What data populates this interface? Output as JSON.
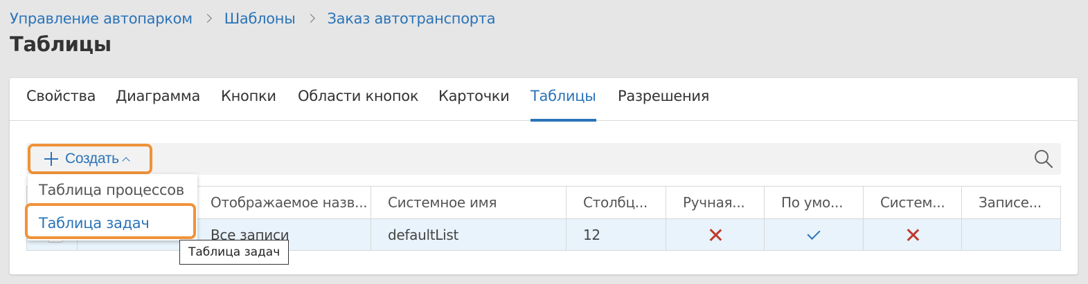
{
  "breadcrumb": {
    "items": [
      "Управление автопарком",
      "Шаблоны",
      "Заказ автотранспорта"
    ]
  },
  "page_title": "Таблицы",
  "tabs": [
    {
      "label": "Свойства",
      "active": false
    },
    {
      "label": "Диаграмма",
      "active": false
    },
    {
      "label": "Кнопки",
      "active": false
    },
    {
      "label": "Области кнопок",
      "active": false
    },
    {
      "label": "Карточки",
      "active": false
    },
    {
      "label": "Таблицы",
      "active": true
    },
    {
      "label": "Разрешения",
      "active": false
    }
  ],
  "toolbar": {
    "create_label": "Создать",
    "create_icon": "plus-icon",
    "search_icon": "search-icon"
  },
  "create_menu": {
    "items": [
      "Таблица процессов",
      "Таблица задач"
    ],
    "highlighted": "Таблица задач"
  },
  "table": {
    "columns": [
      "Отображаемое назв...",
      "Системное имя",
      "Столбц...",
      "Ручная...",
      "По умо...",
      "Систем...",
      "Записе..."
    ],
    "rows": [
      {
        "display_name": "Все записи",
        "system_name": "defaultList",
        "columns": "12",
        "manual": "x-icon",
        "default": "check-icon",
        "system": "x-icon",
        "records": ""
      }
    ]
  },
  "tooltip": "Таблица задач",
  "colors": {
    "accent": "#2a73b8",
    "highlight_outline": "#f0923a",
    "error_icon": "#c0392b",
    "selected_row": "#e8f3fb"
  }
}
